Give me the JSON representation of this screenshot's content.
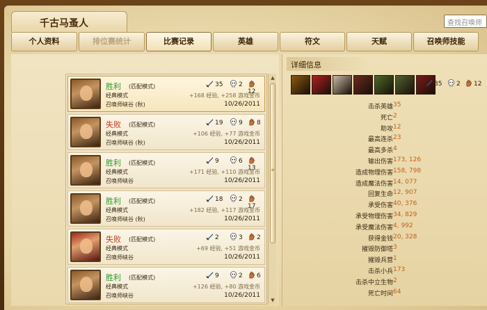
{
  "window_title": "千古马蚤人",
  "search": {
    "placeholder": "查找召唤师"
  },
  "tabs": [
    {
      "label": "个人资料"
    },
    {
      "label": "排位赛统计",
      "disabled": true
    },
    {
      "label": "比赛记录",
      "active": true
    },
    {
      "label": "英雄"
    },
    {
      "label": "符文"
    },
    {
      "label": "天赋"
    },
    {
      "label": "召唤师技能"
    }
  ],
  "matches": [
    {
      "result": "胜利",
      "win": true,
      "mode": "(匹配模式)",
      "type": "经典模式",
      "map": "召唤师峡谷 (秋)",
      "kills": "35",
      "deaths": "2",
      "assists": "12",
      "gain": "+168 经验, +258 游戏金币",
      "date": "10/26/2011",
      "portrait": "warrior"
    },
    {
      "result": "失败",
      "win": false,
      "mode": "(匹配模式)",
      "type": "经典模式",
      "map": "召唤师峡谷 (秋)",
      "kills": "19",
      "deaths": "9",
      "assists": "8",
      "gain": "+106 经验, +77 游戏金币",
      "date": "10/26/2011",
      "portrait": "warrior"
    },
    {
      "result": "胜利",
      "win": true,
      "mode": "(匹配模式)",
      "type": "经典模式",
      "map": "召唤师峡谷",
      "kills": "9",
      "deaths": "6",
      "assists": "13",
      "gain": "+171 经验, +110 游戏金币",
      "date": "10/26/2011",
      "portrait": "warrior"
    },
    {
      "result": "胜利",
      "win": true,
      "mode": "(匹配模式)",
      "type": "经典模式",
      "map": "召唤师峡谷 (秋)",
      "kills": "18",
      "deaths": "2",
      "assists": "17",
      "gain": "+182 经验, +117 游戏金币",
      "date": "10/26/2011",
      "portrait": "warrior"
    },
    {
      "result": "失败",
      "win": false,
      "mode": "(匹配模式)",
      "type": "经典模式",
      "map": "召唤师峡谷",
      "kills": "2",
      "deaths": "3",
      "assists": "2",
      "gain": "+69 经验, +51 游戏金币",
      "date": "10/26/2011",
      "portrait": "redhair"
    },
    {
      "result": "胜利",
      "win": true,
      "mode": "(匹配模式)",
      "type": "经典模式",
      "map": "召唤师峡谷",
      "kills": "9",
      "deaths": "2",
      "assists": "6",
      "gain": "+126 经验, +80 游戏金币",
      "date": "10/26/2011",
      "portrait": "warrior"
    }
  ],
  "detail": {
    "header": "详细信息",
    "summary": {
      "kills": "35",
      "deaths": "2",
      "assists": "12"
    },
    "items": [
      "item-1",
      "item-2",
      "item-3",
      "item-4",
      "item-5",
      "item-6",
      "item-7"
    ],
    "stats": [
      {
        "label": "击杀英雄",
        "value": "35"
      },
      {
        "label": "死亡",
        "value": "2"
      },
      {
        "label": "助攻",
        "value": "12"
      },
      {
        "label": "最高连杀",
        "value": "23"
      },
      {
        "label": "最高多杀",
        "value": "4"
      },
      {
        "label": "输出伤害",
        "value": "173, 126"
      },
      {
        "label": "造成物理伤害",
        "value": "158, 798"
      },
      {
        "label": "造成魔法伤害",
        "value": "14, 077"
      },
      {
        "label": "回复生命",
        "value": "12, 907"
      },
      {
        "label": "承受伤害",
        "value": "40, 376"
      },
      {
        "label": "承受物理伤害",
        "value": "34, 829"
      },
      {
        "label": "承受魔法伤害",
        "value": "4, 992"
      },
      {
        "label": "获得金钱",
        "value": "20, 328"
      },
      {
        "label": "摧毁防御塔",
        "value": "3"
      },
      {
        "label": "摧毁兵营",
        "value": "1"
      },
      {
        "label": "击杀小兵",
        "value": "173"
      },
      {
        "label": "击杀中立生物",
        "value": "2"
      },
      {
        "label": "死亡时间",
        "value": "64"
      }
    ]
  },
  "colors": {
    "win": "#2c9a2c",
    "loss": "#c83a1e",
    "stat_value": "#c0601a"
  }
}
